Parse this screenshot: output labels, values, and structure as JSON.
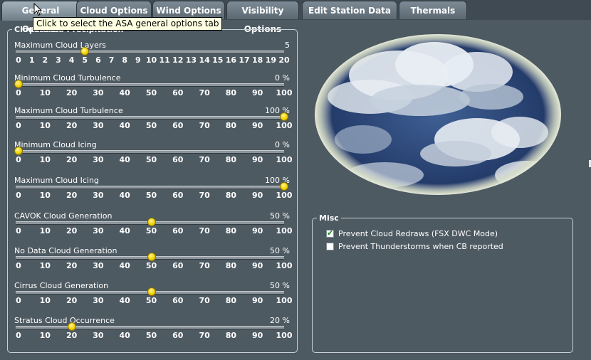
{
  "tabs": [
    {
      "label": "General Options",
      "active": true
    },
    {
      "label": "Cloud Options",
      "active": false
    },
    {
      "label": "Wind Options",
      "active": false
    },
    {
      "label": "Visibility Options",
      "active": false
    },
    {
      "label": "Edit Station Data",
      "active": false
    },
    {
      "label": "Thermals",
      "active": false
    }
  ],
  "tooltip": "Click to select the ASA general options tab",
  "clouds_group": {
    "legend": "Clouds And Precipitation",
    "sliders": [
      {
        "label": "Maximum Cloud Layers",
        "value_text": "5",
        "value": 5,
        "min": 0,
        "max": 20,
        "ticks": [
          "0",
          "1",
          "2",
          "3",
          "4",
          "5",
          "6",
          "7",
          "8",
          "9",
          "10",
          "11",
          "12",
          "13",
          "14",
          "15",
          "16",
          "17",
          "18",
          "19",
          "20"
        ]
      },
      {
        "label": "Minimum Cloud Turbulence",
        "value_text": "0 %",
        "value": 0,
        "min": 0,
        "max": 100,
        "ticks": [
          "0",
          "10",
          "20",
          "30",
          "40",
          "50",
          "60",
          "70",
          "80",
          "90",
          "100"
        ]
      },
      {
        "label": "Maximum Cloud Turbulence",
        "value_text": "100 %",
        "value": 100,
        "min": 0,
        "max": 100,
        "ticks": [
          "0",
          "10",
          "20",
          "30",
          "40",
          "50",
          "60",
          "70",
          "80",
          "90",
          "100"
        ]
      },
      {
        "label": "Minimum Cloud Icing",
        "value_text": "0 %",
        "value": 0,
        "min": 0,
        "max": 100,
        "ticks": [
          "0",
          "10",
          "20",
          "30",
          "40",
          "50",
          "60",
          "70",
          "80",
          "90",
          "100"
        ]
      },
      {
        "label": "Maximum Cloud Icing",
        "value_text": "100 %",
        "value": 100,
        "min": 0,
        "max": 100,
        "ticks": [
          "0",
          "10",
          "20",
          "30",
          "40",
          "50",
          "60",
          "70",
          "80",
          "90",
          "100"
        ]
      },
      {
        "label": "CAVOK Cloud Generation",
        "value_text": "50 %",
        "value": 50,
        "min": 0,
        "max": 100,
        "ticks": [
          "0",
          "10",
          "20",
          "30",
          "40",
          "50",
          "60",
          "70",
          "80",
          "90",
          "100"
        ]
      },
      {
        "label": "No Data Cloud Generation",
        "value_text": "50 %",
        "value": 50,
        "min": 0,
        "max": 100,
        "ticks": [
          "0",
          "10",
          "20",
          "30",
          "40",
          "50",
          "60",
          "70",
          "80",
          "90",
          "100"
        ]
      },
      {
        "label": "Cirrus Cloud Generation",
        "value_text": "50 %",
        "value": 50,
        "min": 0,
        "max": 100,
        "ticks": [
          "0",
          "10",
          "20",
          "30",
          "40",
          "50",
          "60",
          "70",
          "80",
          "90",
          "100"
        ]
      },
      {
        "label": "Stratus Cloud Occurrence",
        "value_text": "20 %",
        "value": 20,
        "min": 0,
        "max": 100,
        "ticks": [
          "0",
          "10",
          "20",
          "30",
          "40",
          "50",
          "60",
          "70",
          "80",
          "90",
          "100"
        ]
      }
    ]
  },
  "misc_group": {
    "legend": "Misc",
    "options": [
      {
        "label": "Prevent Cloud Redraws (FSX DWC Mode)",
        "checked": true
      },
      {
        "label": "Prevent Thunderstorms when CB reported",
        "checked": false
      }
    ]
  },
  "colors": {
    "thumb": "#f2d200",
    "background": "#4e5a62",
    "check": "#1a8a1a"
  }
}
